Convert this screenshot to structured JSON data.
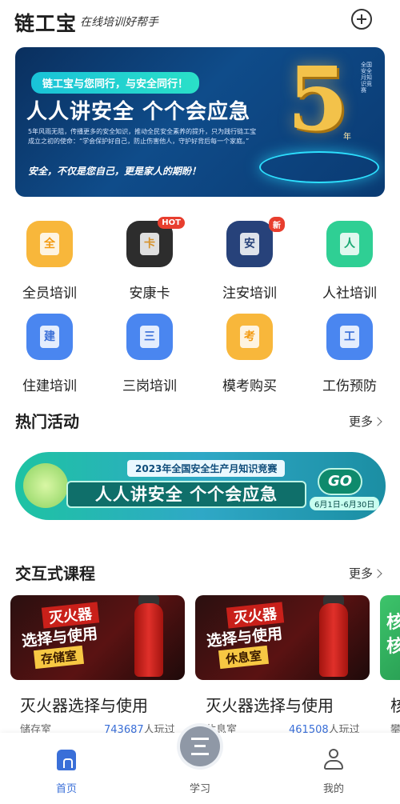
{
  "header": {
    "logo": "链工宝",
    "slogan": "在线培训好帮手",
    "add_icon": "plus-circle-icon"
  },
  "banner": {
    "tag": "链工宝与您同行，与安全同行！",
    "title": "人人讲安全 个个会应急",
    "desc": "5年风雨无阻，传播更多的安全知识，推动全民安全素养的提升，只为践行链工宝成立之初的使命：“学会保护好自己，防止伤害他人，守护好背后每一个家庭。”",
    "footer": "安全，不仅是您自己，更是家人的期盼！",
    "big_number": "5",
    "year_label": "年",
    "side_text": "全国安全月知识竞赛",
    "dots_total": 6,
    "dots_active": 0
  },
  "grid": [
    {
      "label": "全员培训",
      "icon": "全",
      "bg": "#f8b73b",
      "fg": "#f39b12"
    },
    {
      "label": "安康卡",
      "icon": "卡",
      "bg": "#2d2d2d",
      "fg": "#d6922a",
      "badge": "HOT",
      "badge_color": "#e83e2e"
    },
    {
      "label": "注安培训",
      "icon": "安",
      "bg": "#27427a",
      "fg": "#27427a",
      "badge": "新",
      "badge_color": "#e83e2e"
    },
    {
      "label": "人社培训",
      "icon": "人",
      "bg": "#2fcf94",
      "fg": "#17a872"
    },
    {
      "label": "住建培训",
      "icon": "建",
      "bg": "#4a86f0",
      "fg": "#3a6fd8"
    },
    {
      "label": "三岗培训",
      "icon": "三",
      "bg": "#4a86f0",
      "fg": "#3a6fd8"
    },
    {
      "label": "模考购买",
      "icon": "考",
      "bg": "#f8b73b",
      "fg": "#f39b12"
    },
    {
      "label": "工伤预防",
      "icon": "工",
      "bg": "#4a86f0",
      "fg": "#3a6fd8"
    }
  ],
  "hot": {
    "title": "热门活动",
    "more": "更多",
    "banner_top": "2023年全国安全生产月知识竞赛",
    "banner_main": "人人讲安全 个个会应急",
    "banner_go": "GO",
    "banner_date": "6月1日-6月30日"
  },
  "courses_section": {
    "title": "交互式课程",
    "more": "更多"
  },
  "courses": [
    {
      "tag": "灭火器",
      "subtitle": "选择与使用",
      "room_tag": "存储室",
      "name": "灭火器选择与使用",
      "room": "储存室",
      "plays": "743687",
      "plays_unit": "人玩过"
    },
    {
      "tag": "灭火器",
      "subtitle": "选择与使用",
      "room_tag": "休息室",
      "name": "灭火器选择与使用",
      "room": "休息室",
      "plays": "461508",
      "plays_unit": "人玩过"
    }
  ],
  "course_peek": {
    "cover": "核核",
    "name": "核",
    "room": "攀"
  },
  "tabbar": [
    {
      "label": "首页",
      "active": true
    },
    {
      "label": "学习",
      "active": false
    },
    {
      "label": "我的",
      "active": false
    }
  ]
}
